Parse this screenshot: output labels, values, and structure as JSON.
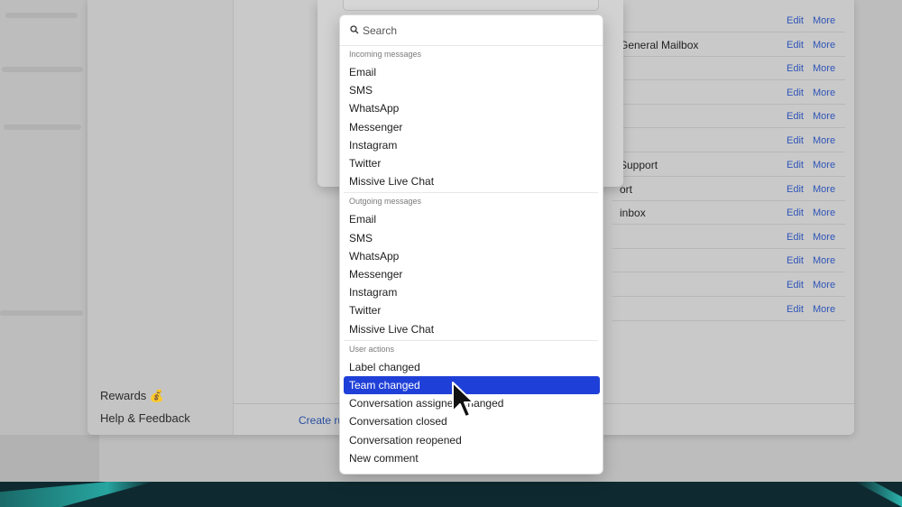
{
  "sidebar": {
    "rewards_label": "Rewards 💰",
    "help_label": "Help & Feedback"
  },
  "main": {
    "create_rule_label": "Create ru",
    "rules": [
      {
        "name": ""
      },
      {
        "name": "General Mailbox"
      },
      {
        "name": ""
      },
      {
        "name": ""
      },
      {
        "name": ""
      },
      {
        "name": ""
      },
      {
        "name": "Support"
      },
      {
        "name": "ort"
      },
      {
        "name": "inbox"
      },
      {
        "name": ""
      },
      {
        "name": ""
      },
      {
        "name": ""
      },
      {
        "name": ""
      }
    ],
    "edit_label": "Edit",
    "more_label": "More"
  },
  "dropdown": {
    "search_placeholder": "Search",
    "groups": [
      {
        "header": "Incoming messages",
        "items": [
          "Email",
          "SMS",
          "WhatsApp",
          "Messenger",
          "Instagram",
          "Twitter",
          "Missive Live Chat"
        ]
      },
      {
        "header": "Outgoing messages",
        "items": [
          "Email",
          "SMS",
          "WhatsApp",
          "Messenger",
          "Instagram",
          "Twitter",
          "Missive Live Chat"
        ]
      },
      {
        "header": "User actions",
        "items": [
          "Label changed",
          "Team changed",
          "Conversation assignee changed",
          "Conversation closed",
          "Conversation reopened",
          "New comment"
        ]
      }
    ],
    "selected_item": "Team changed"
  },
  "colors": {
    "selection": "#1f40d8",
    "link": "#2f55b8",
    "accent_band": "#0e2a30"
  },
  "icons": [
    "search-icon",
    "mouse-cursor-icon"
  ]
}
